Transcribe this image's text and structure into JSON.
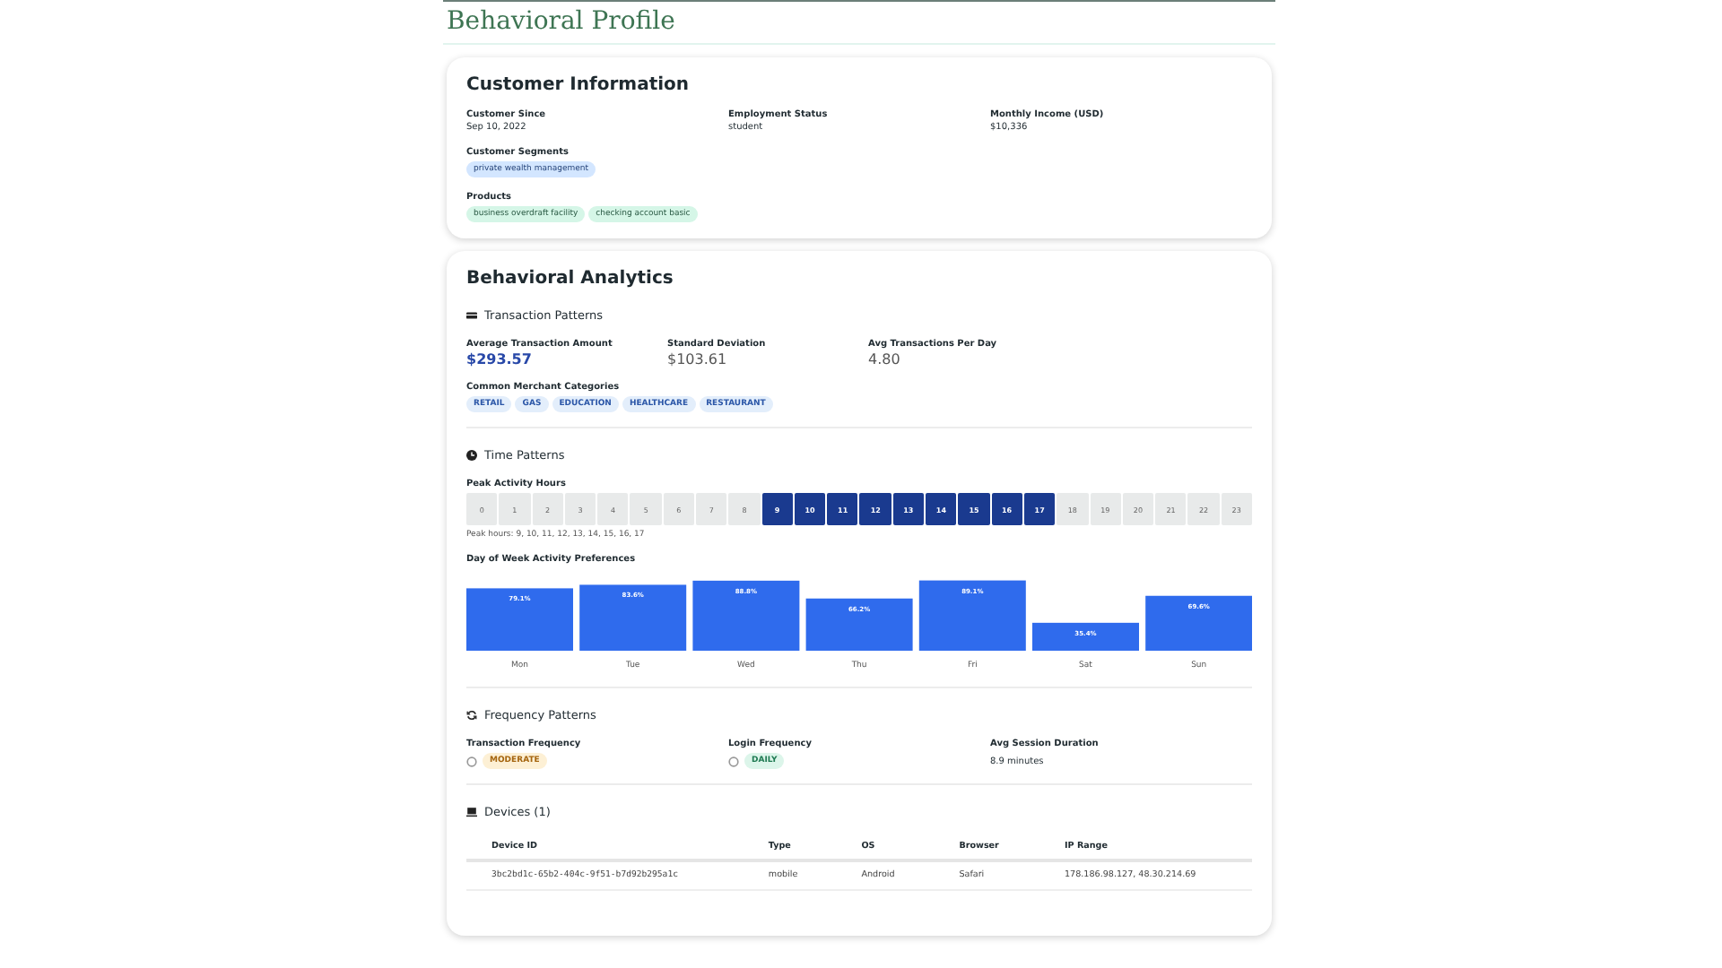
{
  "page_title": "Behavioral Profile",
  "customer_information": {
    "title": "Customer Information",
    "fields": [
      {
        "label": "Customer Since",
        "value": "Sep 10, 2022"
      },
      {
        "label": "Employment Status",
        "value": "student"
      },
      {
        "label": "Monthly Income (USD)",
        "value": "$10,336"
      }
    ],
    "segments_label": "Customer Segments",
    "segments": [
      "private wealth management"
    ],
    "products_label": "Products",
    "products": [
      "business overdraft facility",
      "checking account basic"
    ]
  },
  "behavioral_analytics": {
    "title": "Behavioral Analytics",
    "transaction_patterns": {
      "title": "Transaction Patterns",
      "metrics": [
        {
          "label": "Average Transaction Amount",
          "value": "$293.57",
          "kind": "primary"
        },
        {
          "label": "Standard Deviation",
          "value": "$103.61",
          "kind": "plain"
        },
        {
          "label": "Avg Transactions Per Day",
          "value": "4.80",
          "kind": "plain"
        }
      ],
      "categories_label": "Common Merchant Categories",
      "categories": [
        "RETAIL",
        "GAS",
        "EDUCATION",
        "HEALTHCARE",
        "RESTAURANT"
      ]
    },
    "time_patterns": {
      "title": "Time Patterns",
      "peak_label": "Peak Activity Hours",
      "hours": [
        {
          "label": "0",
          "peak": false
        },
        {
          "label": "1",
          "peak": false
        },
        {
          "label": "2",
          "peak": false
        },
        {
          "label": "3",
          "peak": false
        },
        {
          "label": "4",
          "peak": false
        },
        {
          "label": "5",
          "peak": false
        },
        {
          "label": "6",
          "peak": false
        },
        {
          "label": "7",
          "peak": false
        },
        {
          "label": "8",
          "peak": false
        },
        {
          "label": "9",
          "peak": true
        },
        {
          "label": "10",
          "peak": true
        },
        {
          "label": "11",
          "peak": true
        },
        {
          "label": "12",
          "peak": true
        },
        {
          "label": "13",
          "peak": true
        },
        {
          "label": "14",
          "peak": true
        },
        {
          "label": "15",
          "peak": true
        },
        {
          "label": "16",
          "peak": true
        },
        {
          "label": "17",
          "peak": true
        },
        {
          "label": "18",
          "peak": false
        },
        {
          "label": "19",
          "peak": false
        },
        {
          "label": "20",
          "peak": false
        },
        {
          "label": "21",
          "peak": false
        },
        {
          "label": "22",
          "peak": false
        },
        {
          "label": "23",
          "peak": false
        }
      ],
      "peak_summary": "Peak hours: 9, 10, 11, 12, 13, 14, 15, 16, 17",
      "day_label": "Day of Week Activity Preferences",
      "chart_data": {
        "type": "bar",
        "categories": [
          "Mon",
          "Tue",
          "Wed",
          "Thu",
          "Fri",
          "Sat",
          "Sun"
        ],
        "values": [
          79.1,
          83.6,
          88.8,
          66.2,
          89.1,
          35.4,
          69.6
        ],
        "color": "#2f6bed",
        "value_labels": [
          "79.1%",
          "83.6%",
          "88.8%",
          "66.2%",
          "89.1%",
          "35.4%",
          "69.6%"
        ]
      }
    },
    "frequency_patterns": {
      "title": "Frequency Patterns",
      "items": [
        {
          "label": "Transaction Frequency",
          "value": "MODERATE",
          "kind": "badge",
          "color": "#fdf0d5"
        },
        {
          "label": "Login Frequency",
          "value": "DAILY",
          "kind": "badge",
          "color": "#dcf5ea"
        },
        {
          "label": "Avg Session Duration",
          "value": "8.9 minutes",
          "kind": "text"
        }
      ]
    },
    "devices": {
      "title": "Devices (1)",
      "columns": [
        "Device ID",
        "Type",
        "OS",
        "Browser",
        "IP Range"
      ],
      "rows": [
        [
          "3bc2bd1c-65b2-404c-9f51-b7d92b295a1c",
          "mobile",
          "Android",
          "Safari",
          "178.186.98.127, 48.30.214.69"
        ]
      ]
    }
  }
}
